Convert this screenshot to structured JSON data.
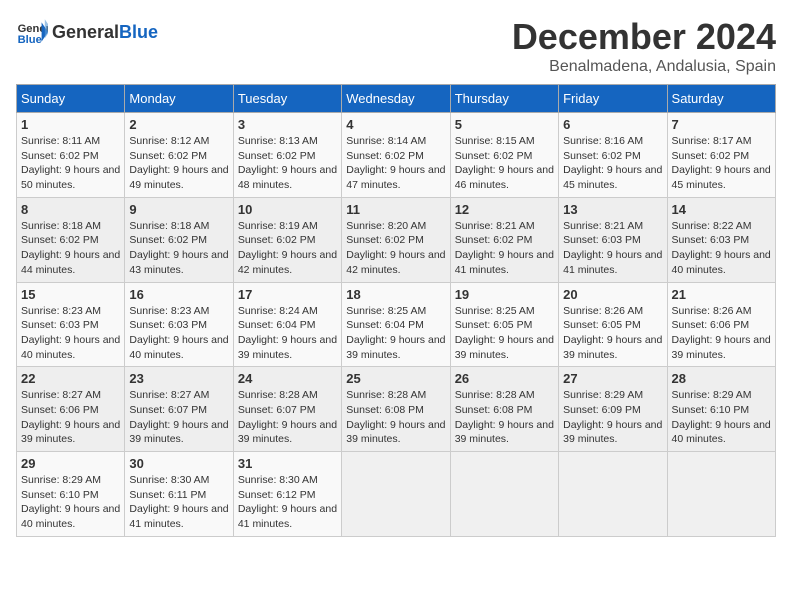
{
  "header": {
    "logo_general": "General",
    "logo_blue": "Blue",
    "month_title": "December 2024",
    "subtitle": "Benalmadena, Andalusia, Spain"
  },
  "weekdays": [
    "Sunday",
    "Monday",
    "Tuesday",
    "Wednesday",
    "Thursday",
    "Friday",
    "Saturday"
  ],
  "weeks": [
    [
      {
        "day": "1",
        "sunrise": "8:11 AM",
        "sunset": "6:02 PM",
        "daylight": "9 hours and 50 minutes."
      },
      {
        "day": "2",
        "sunrise": "8:12 AM",
        "sunset": "6:02 PM",
        "daylight": "9 hours and 49 minutes."
      },
      {
        "day": "3",
        "sunrise": "8:13 AM",
        "sunset": "6:02 PM",
        "daylight": "9 hours and 48 minutes."
      },
      {
        "day": "4",
        "sunrise": "8:14 AM",
        "sunset": "6:02 PM",
        "daylight": "9 hours and 47 minutes."
      },
      {
        "day": "5",
        "sunrise": "8:15 AM",
        "sunset": "6:02 PM",
        "daylight": "9 hours and 46 minutes."
      },
      {
        "day": "6",
        "sunrise": "8:16 AM",
        "sunset": "6:02 PM",
        "daylight": "9 hours and 45 minutes."
      },
      {
        "day": "7",
        "sunrise": "8:17 AM",
        "sunset": "6:02 PM",
        "daylight": "9 hours and 45 minutes."
      }
    ],
    [
      {
        "day": "8",
        "sunrise": "8:18 AM",
        "sunset": "6:02 PM",
        "daylight": "9 hours and 44 minutes."
      },
      {
        "day": "9",
        "sunrise": "8:18 AM",
        "sunset": "6:02 PM",
        "daylight": "9 hours and 43 minutes."
      },
      {
        "day": "10",
        "sunrise": "8:19 AM",
        "sunset": "6:02 PM",
        "daylight": "9 hours and 42 minutes."
      },
      {
        "day": "11",
        "sunrise": "8:20 AM",
        "sunset": "6:02 PM",
        "daylight": "9 hours and 42 minutes."
      },
      {
        "day": "12",
        "sunrise": "8:21 AM",
        "sunset": "6:02 PM",
        "daylight": "9 hours and 41 minutes."
      },
      {
        "day": "13",
        "sunrise": "8:21 AM",
        "sunset": "6:03 PM",
        "daylight": "9 hours and 41 minutes."
      },
      {
        "day": "14",
        "sunrise": "8:22 AM",
        "sunset": "6:03 PM",
        "daylight": "9 hours and 40 minutes."
      }
    ],
    [
      {
        "day": "15",
        "sunrise": "8:23 AM",
        "sunset": "6:03 PM",
        "daylight": "9 hours and 40 minutes."
      },
      {
        "day": "16",
        "sunrise": "8:23 AM",
        "sunset": "6:03 PM",
        "daylight": "9 hours and 40 minutes."
      },
      {
        "day": "17",
        "sunrise": "8:24 AM",
        "sunset": "6:04 PM",
        "daylight": "9 hours and 39 minutes."
      },
      {
        "day": "18",
        "sunrise": "8:25 AM",
        "sunset": "6:04 PM",
        "daylight": "9 hours and 39 minutes."
      },
      {
        "day": "19",
        "sunrise": "8:25 AM",
        "sunset": "6:05 PM",
        "daylight": "9 hours and 39 minutes."
      },
      {
        "day": "20",
        "sunrise": "8:26 AM",
        "sunset": "6:05 PM",
        "daylight": "9 hours and 39 minutes."
      },
      {
        "day": "21",
        "sunrise": "8:26 AM",
        "sunset": "6:06 PM",
        "daylight": "9 hours and 39 minutes."
      }
    ],
    [
      {
        "day": "22",
        "sunrise": "8:27 AM",
        "sunset": "6:06 PM",
        "daylight": "9 hours and 39 minutes."
      },
      {
        "day": "23",
        "sunrise": "8:27 AM",
        "sunset": "6:07 PM",
        "daylight": "9 hours and 39 minutes."
      },
      {
        "day": "24",
        "sunrise": "8:28 AM",
        "sunset": "6:07 PM",
        "daylight": "9 hours and 39 minutes."
      },
      {
        "day": "25",
        "sunrise": "8:28 AM",
        "sunset": "6:08 PM",
        "daylight": "9 hours and 39 minutes."
      },
      {
        "day": "26",
        "sunrise": "8:28 AM",
        "sunset": "6:08 PM",
        "daylight": "9 hours and 39 minutes."
      },
      {
        "day": "27",
        "sunrise": "8:29 AM",
        "sunset": "6:09 PM",
        "daylight": "9 hours and 39 minutes."
      },
      {
        "day": "28",
        "sunrise": "8:29 AM",
        "sunset": "6:10 PM",
        "daylight": "9 hours and 40 minutes."
      }
    ],
    [
      {
        "day": "29",
        "sunrise": "8:29 AM",
        "sunset": "6:10 PM",
        "daylight": "9 hours and 40 minutes."
      },
      {
        "day": "30",
        "sunrise": "8:30 AM",
        "sunset": "6:11 PM",
        "daylight": "9 hours and 41 minutes."
      },
      {
        "day": "31",
        "sunrise": "8:30 AM",
        "sunset": "6:12 PM",
        "daylight": "9 hours and 41 minutes."
      },
      null,
      null,
      null,
      null
    ]
  ]
}
